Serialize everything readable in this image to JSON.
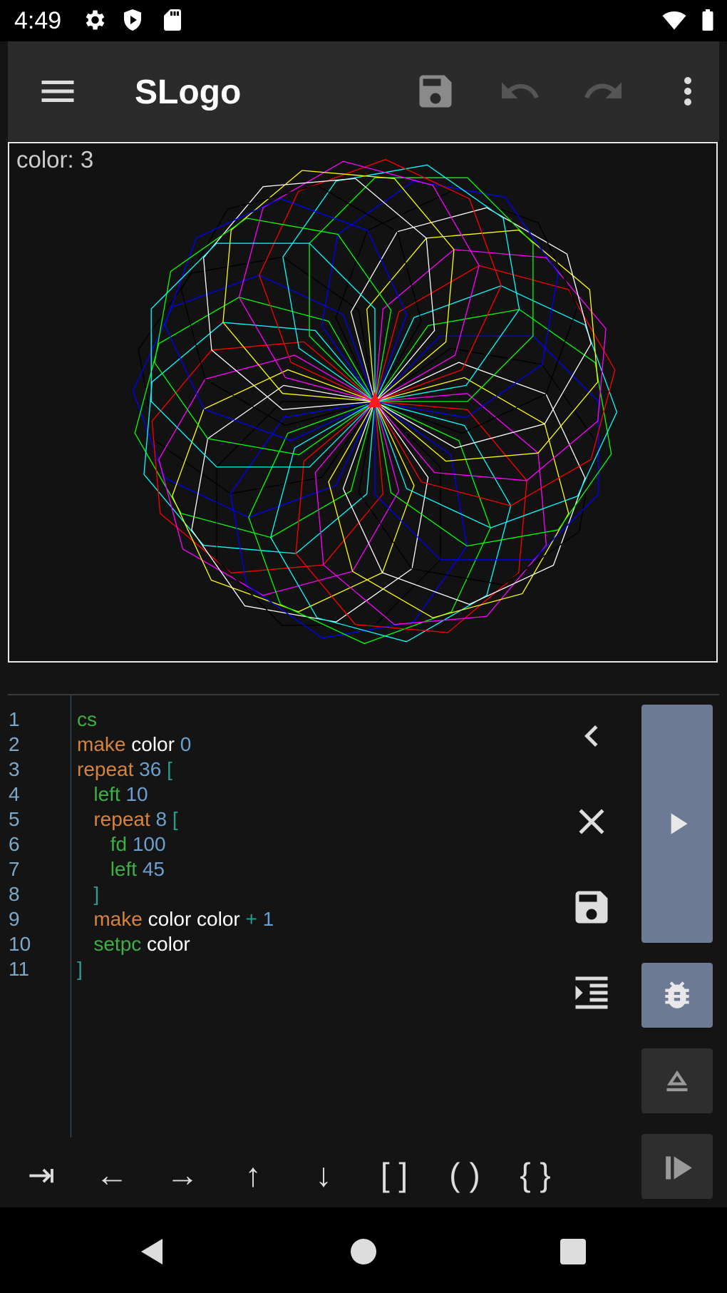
{
  "status_bar": {
    "time": "4:49",
    "icons": [
      "gear-icon",
      "shield-play-icon",
      "sd-card-icon",
      "wifi-icon",
      "battery-icon"
    ]
  },
  "app_bar": {
    "title": "SLogo",
    "actions": [
      "menu-icon",
      "save-icon",
      "undo-icon",
      "redo-icon",
      "more-vert-icon"
    ]
  },
  "canvas": {
    "overlay_text": "color: 3"
  },
  "editor": {
    "line_numbers": [
      "1",
      "2",
      "3",
      "4",
      "5",
      "6",
      "7",
      "8",
      "9",
      "10",
      "11"
    ],
    "lines": [
      [
        {
          "t": "cs",
          "c": "kw-green"
        }
      ],
      [
        {
          "t": "make",
          "c": "kw-orange"
        },
        {
          "t": " color ",
          "c": "ident"
        },
        {
          "t": "0",
          "c": "num-blue"
        }
      ],
      [
        {
          "t": "repeat",
          "c": "kw-orange"
        },
        {
          "t": " 36 ",
          "c": "num-blue"
        },
        {
          "t": "[",
          "c": "bracket"
        }
      ],
      [
        {
          "t": "   ",
          "c": "ident"
        },
        {
          "t": "left",
          "c": "kw-green"
        },
        {
          "t": " 10",
          "c": "num-blue"
        }
      ],
      [
        {
          "t": "   ",
          "c": "ident"
        },
        {
          "t": "repeat",
          "c": "kw-orange"
        },
        {
          "t": " 8 ",
          "c": "num-blue"
        },
        {
          "t": "[",
          "c": "bracket"
        }
      ],
      [
        {
          "t": "      ",
          "c": "ident"
        },
        {
          "t": "fd",
          "c": "kw-green"
        },
        {
          "t": " 100",
          "c": "num-blue"
        }
      ],
      [
        {
          "t": "      ",
          "c": "ident"
        },
        {
          "t": "left",
          "c": "kw-green"
        },
        {
          "t": " 45",
          "c": "num-blue"
        }
      ],
      [
        {
          "t": "   ",
          "c": "ident"
        },
        {
          "t": "]",
          "c": "bracket"
        }
      ],
      [
        {
          "t": "   ",
          "c": "ident"
        },
        {
          "t": "make",
          "c": "kw-orange"
        },
        {
          "t": " color color ",
          "c": "ident"
        },
        {
          "t": "+ ",
          "c": "bracket"
        },
        {
          "t": "1",
          "c": "num-blue"
        }
      ],
      [
        {
          "t": "   ",
          "c": "ident"
        },
        {
          "t": "setpc",
          "c": "kw-green"
        },
        {
          "t": " color",
          "c": "ident"
        }
      ],
      [
        {
          "t": "]",
          "c": "bracket"
        }
      ]
    ]
  },
  "side_tools": [
    "chevron-left-icon",
    "close-icon",
    "save-icon",
    "indent-icon"
  ],
  "run_panel": [
    "play-icon",
    "bug-icon",
    "eject-icon",
    "step-icon"
  ],
  "key_bar": {
    "keys": [
      "⇥",
      "←",
      "→",
      "↑",
      "↓",
      "[ ]",
      "( )",
      "{ }"
    ]
  },
  "nav_bar": [
    "back-icon",
    "home-icon",
    "recents-icon"
  ],
  "colors": {
    "accent_run": "#6d7a94",
    "canvas_bg": "#121212",
    "keyword_green": "#3cb043",
    "keyword_orange": "#d4843c",
    "number_blue": "#6a9fd0"
  }
}
